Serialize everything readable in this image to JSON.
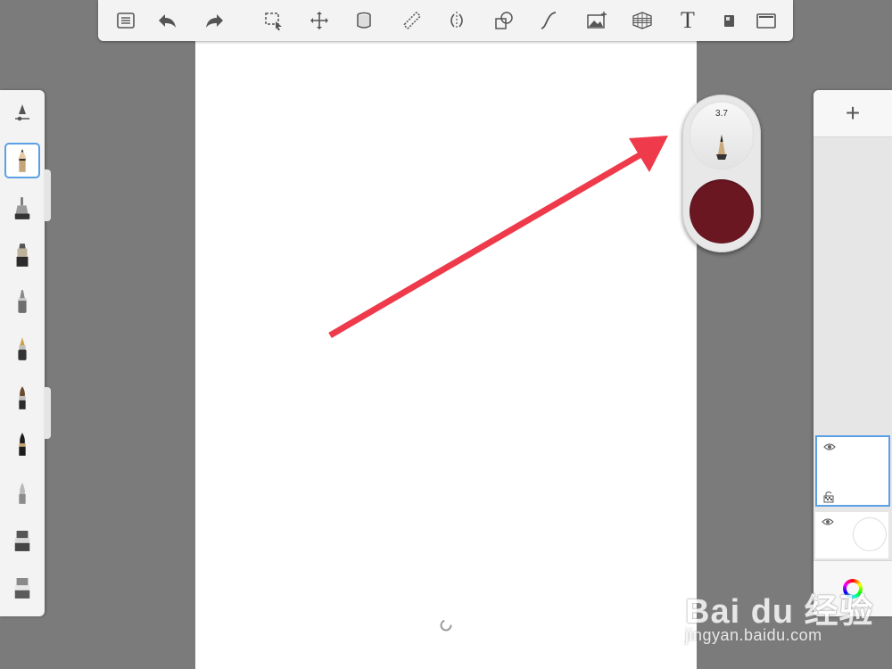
{
  "app": {
    "top_toolbar": [
      {
        "name": "menu-list-icon"
      },
      {
        "name": "undo-icon"
      },
      {
        "name": "redo-icon"
      },
      {
        "name": "selection-icon"
      },
      {
        "name": "transform-move-icon"
      },
      {
        "name": "fill-bucket-icon"
      },
      {
        "name": "ruler-icon"
      },
      {
        "name": "symmetry-icon"
      },
      {
        "name": "shapes-icon"
      },
      {
        "name": "curve-icon"
      },
      {
        "name": "image-insert-icon"
      },
      {
        "name": "perspective-grid-icon"
      },
      {
        "name": "text-icon",
        "label": "T"
      },
      {
        "name": "layer-badge-icon"
      },
      {
        "name": "fullscreen-icon"
      }
    ],
    "brushes": [
      {
        "name": "pencil-brush",
        "selected": true
      },
      {
        "name": "airbrush-brush",
        "selected": false
      },
      {
        "name": "marker-brush",
        "selected": false
      },
      {
        "name": "ballpoint-brush",
        "selected": false
      },
      {
        "name": "fountain-pen-brush",
        "selected": false
      },
      {
        "name": "paintbrush-brush",
        "selected": false
      },
      {
        "name": "ink-brush",
        "selected": false
      },
      {
        "name": "smudge-brush",
        "selected": false
      },
      {
        "name": "eraser-brush",
        "selected": false
      },
      {
        "name": "soft-eraser-brush",
        "selected": false
      }
    ],
    "puck": {
      "brush_size": "3.7",
      "color": "#6b1722"
    },
    "layers": {
      "add_label": "+",
      "items": [
        {
          "name": "layer-1",
          "visible": true,
          "selected": true
        },
        {
          "name": "background-layer",
          "visible": true,
          "selected": false
        }
      ]
    },
    "watermark": {
      "brand_text": "Bai du 经验",
      "url": "jingyan.baidu.com"
    },
    "colors": {
      "annotation_arrow": "#ee3a4a",
      "accent": "#5aa0e6",
      "canvas_bg": "#ffffff",
      "workspace_bg": "#7b7b7b"
    }
  }
}
